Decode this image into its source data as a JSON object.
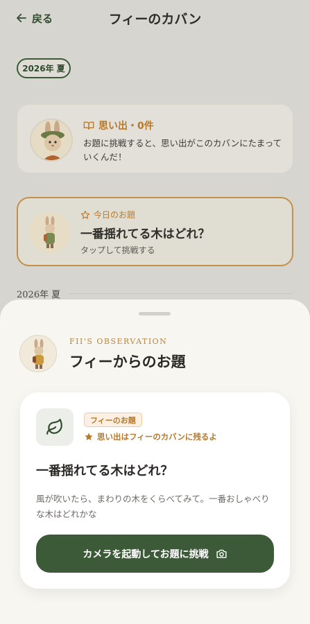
{
  "header": {
    "back_label": "戻る",
    "title": "フィーのカバン"
  },
  "season_chip": "2026年 夏",
  "memory_card": {
    "title": "思い出・0件",
    "description": "お題に挑戦すると、思い出がこのカバンにたまっていくんだ！"
  },
  "today_card": {
    "label": "今日のお題",
    "question": "一番揺れてる木はどれ？",
    "tap_hint": "タップして挑戦する"
  },
  "section_label": "2026年 夏",
  "sheet": {
    "eyebrow": "FII'S OBSERVATION",
    "title": "フィーからのお題",
    "card": {
      "tag": "フィーのお題",
      "remain_note": "思い出はフィーのカバンに残るよ",
      "question": "一番揺れてる木はどれ？",
      "description": "風が吹いたら、まわりの木をくらべてみて。一番おしゃべりな木はどれかな",
      "camera_button": "カメラを起動してお題に挑戦"
    }
  },
  "colors": {
    "accent_green": "#3c5a38",
    "accent_orange": "#b7792a",
    "sheet_bg": "#f7f6f1"
  },
  "icons": {
    "back": "arrow-left-icon",
    "book": "book-open-icon",
    "star_outline": "star-outline-icon",
    "leaf": "leaf-icon",
    "star_filled": "star-icon",
    "camera": "camera-icon"
  }
}
